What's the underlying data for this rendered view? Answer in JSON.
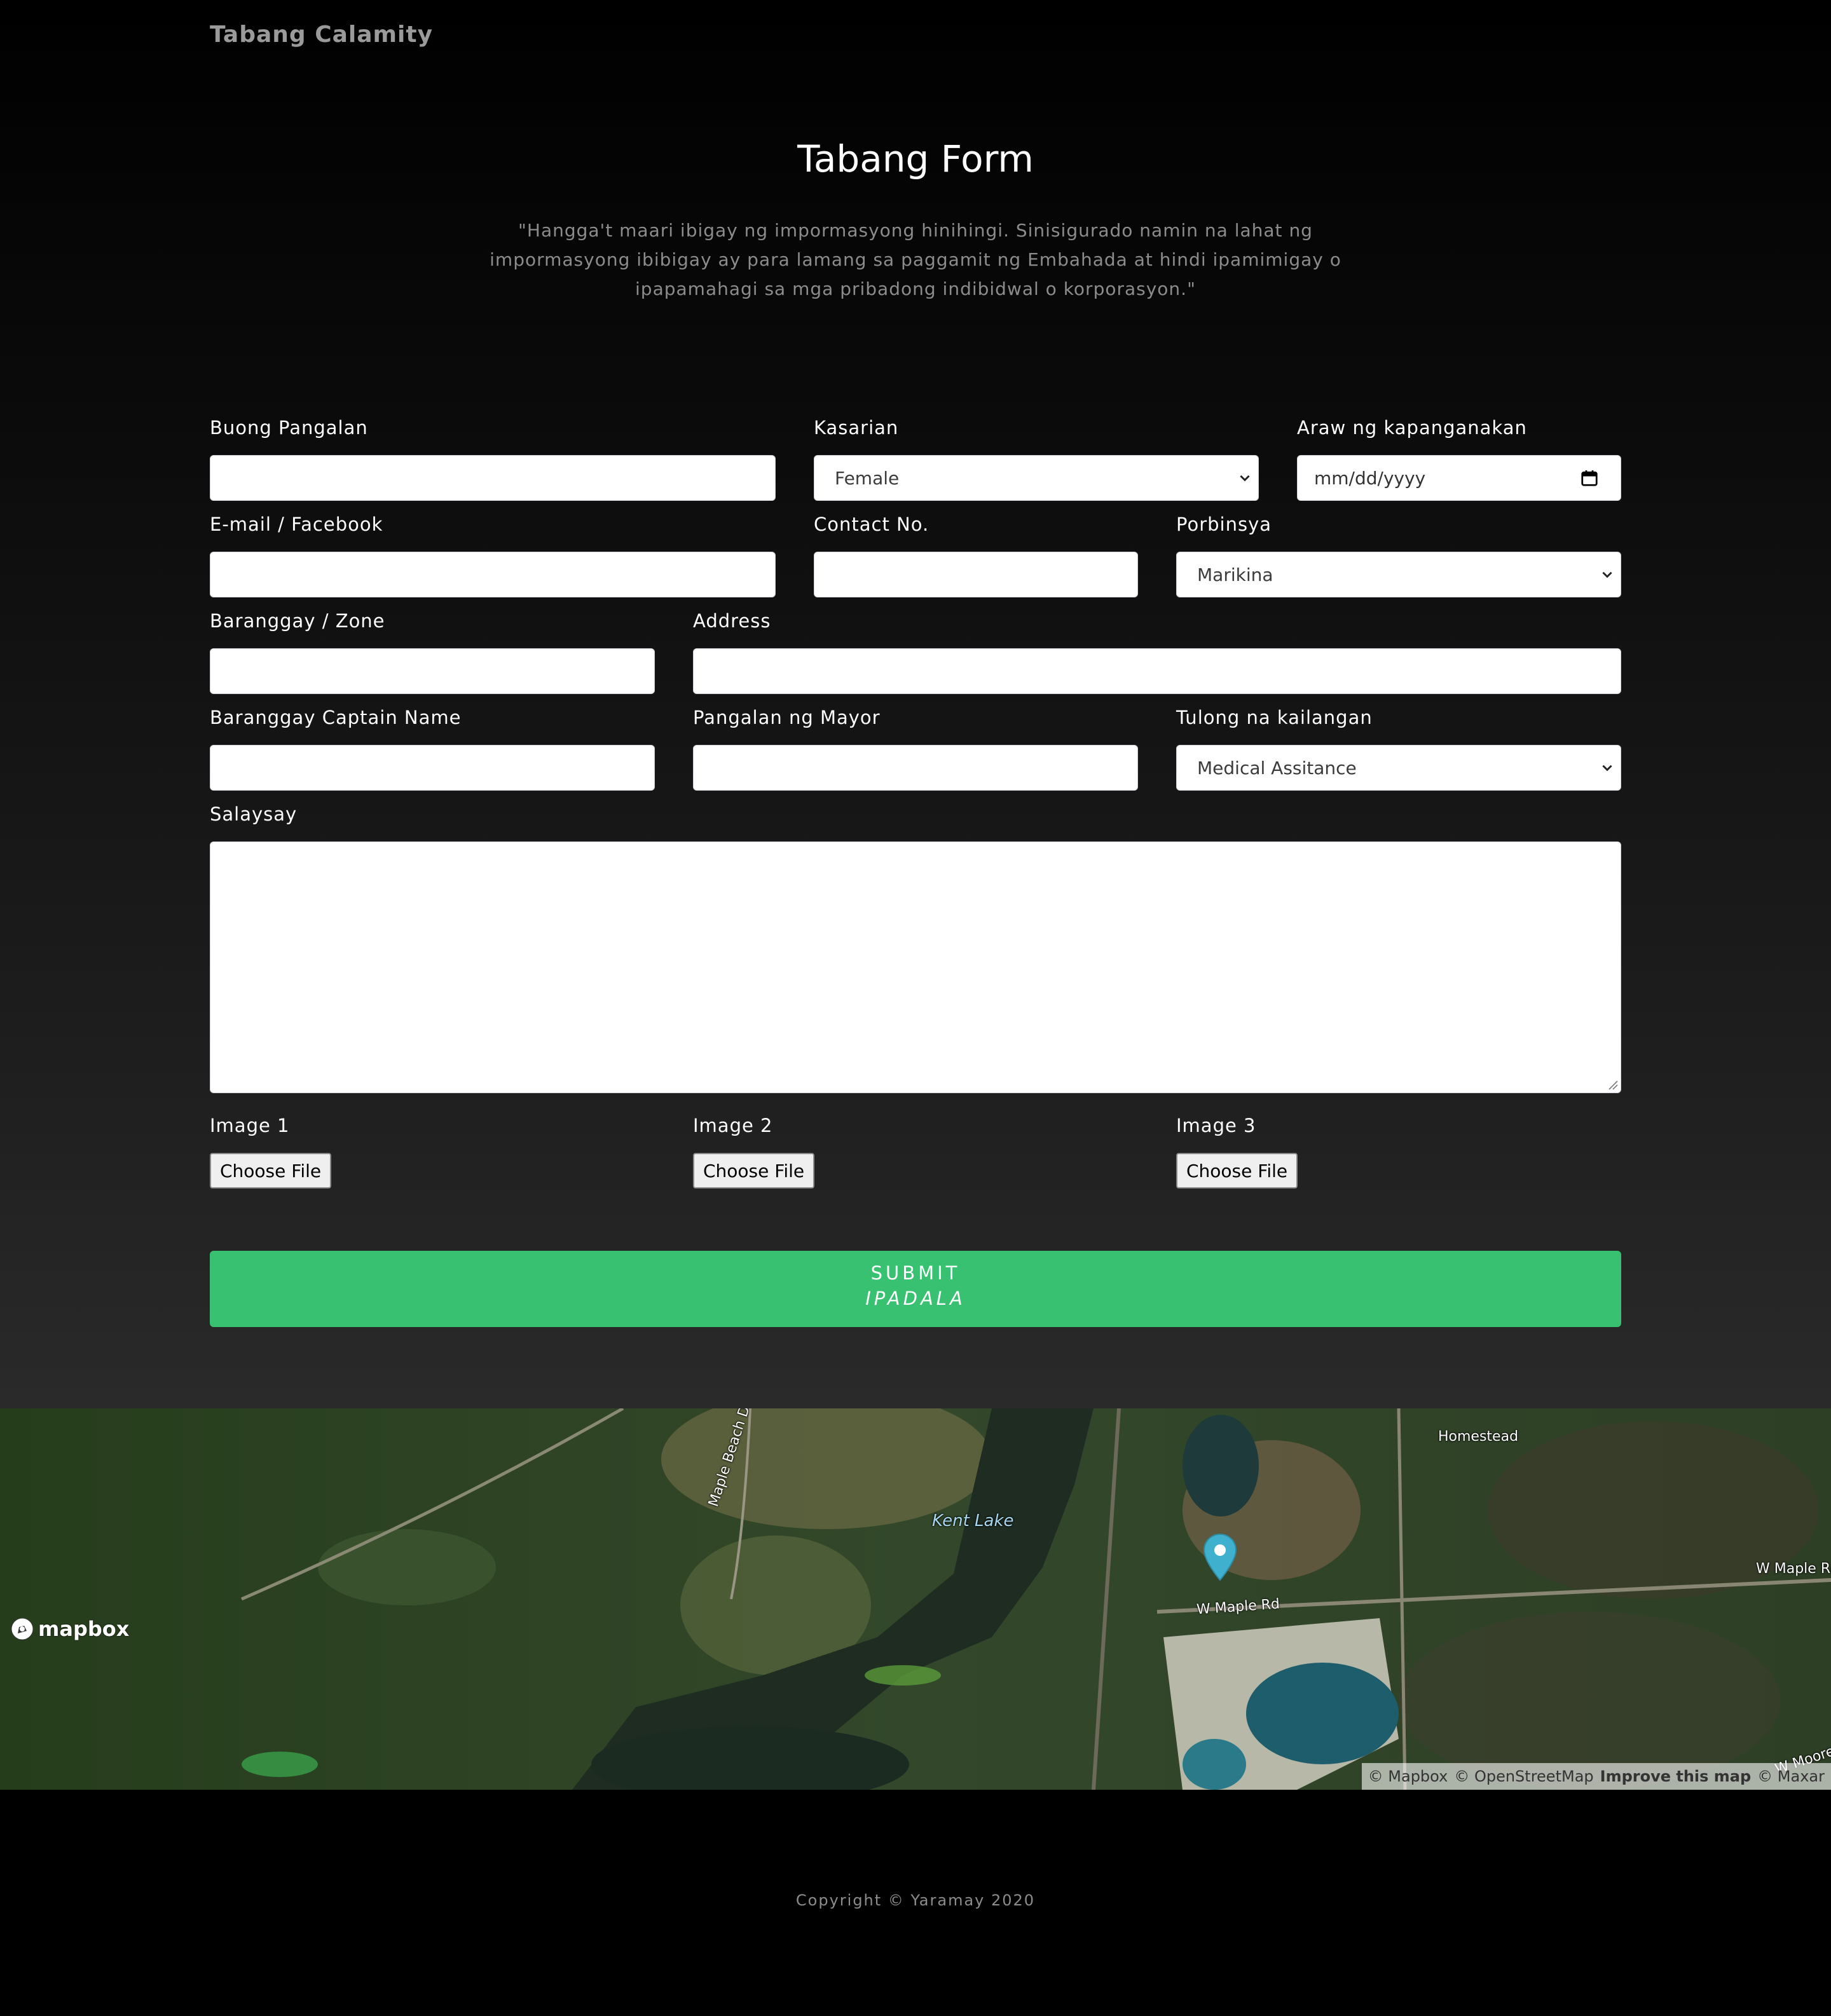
{
  "brand": "Tabang Calamity",
  "title": "Tabang Form",
  "subtitle": "\"Hangga't maari ibigay ng impormasyong hinihingi. Sinisigurado namin na lahat ng impormasyong ibibigay ay para lamang sa paggamit ng Embahada at hindi ipamimigay o ipapamahagi sa mga pribadong indibidwal o korporasyon.\"",
  "form": {
    "full_name": {
      "label": "Buong Pangalan",
      "value": ""
    },
    "gender": {
      "label": "Kasarian",
      "selected": "Female"
    },
    "birthdate": {
      "label": "Araw ng kapanganakan",
      "placeholder": "mm/dd/yyyy"
    },
    "email": {
      "label": "E-mail / Facebook",
      "value": ""
    },
    "contact": {
      "label": "Contact No.",
      "value": ""
    },
    "province": {
      "label": "Porbinsya",
      "selected": "Marikina"
    },
    "barangay": {
      "label": "Baranggay / Zone",
      "value": ""
    },
    "address": {
      "label": "Address",
      "value": ""
    },
    "captain": {
      "label": "Baranggay Captain Name",
      "value": ""
    },
    "mayor": {
      "label": "Pangalan ng Mayor",
      "value": ""
    },
    "help": {
      "label": "Tulong na kailangan",
      "selected": "Medical Assitance"
    },
    "story": {
      "label": "Salaysay",
      "value": ""
    },
    "image1": {
      "label": "Image 1",
      "button": "Choose File"
    },
    "image2": {
      "label": "Image 2",
      "button": "Choose File"
    },
    "image3": {
      "label": "Image 3",
      "button": "Choose File"
    },
    "submit": {
      "line1": "SUBMIT",
      "line2": "IPADALA"
    }
  },
  "map": {
    "labels": {
      "homestead": "Homestead",
      "maple_beach": "Maple Beach Dr",
      "kent_lake": "Kent Lake",
      "w_maple_rd": "W Maple Rd",
      "w_maple_rd_east": "W Maple Rd",
      "w_moore": "W Moore R"
    },
    "logo": "mapbox",
    "attribution": {
      "mapbox": "© Mapbox",
      "osm": "© OpenStreetMap",
      "improve": "Improve this map",
      "maxar": "© Maxar"
    },
    "pin_color": "#3fb1ce"
  },
  "footer": "Copyright © Yaramay 2020",
  "colors": {
    "accent": "#39c172",
    "background": "#000000"
  }
}
